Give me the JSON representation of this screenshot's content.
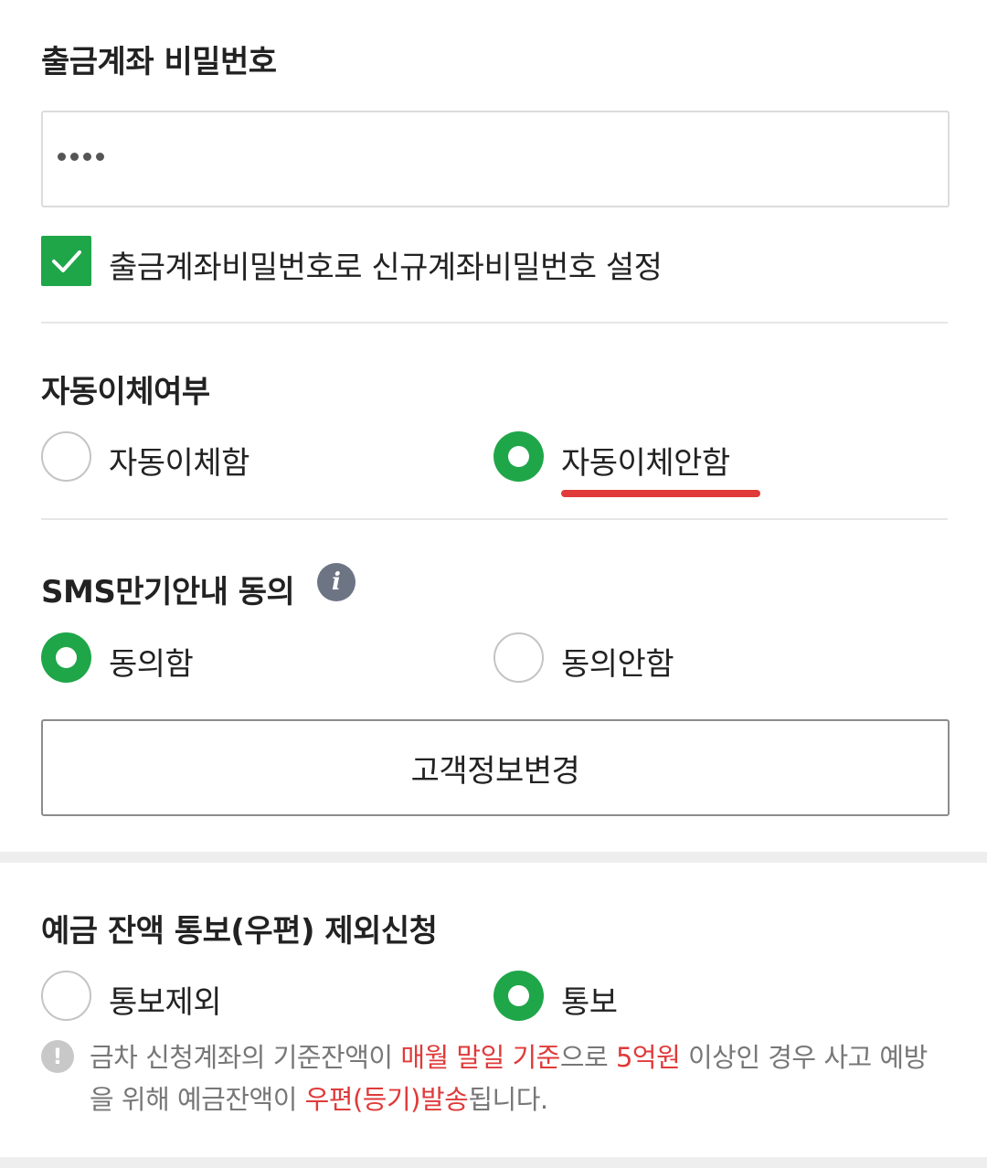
{
  "password_section": {
    "title": "출금계좌 비밀번호",
    "input_masked_length": 4,
    "checkbox_label": "출금계좌비밀번호로 신규계좌비밀번호 설정",
    "checkbox_checked": true
  },
  "auto_transfer": {
    "title": "자동이체여부",
    "options": [
      {
        "label": "자동이체함",
        "selected": false
      },
      {
        "label": "자동이체안함",
        "selected": true
      }
    ]
  },
  "sms_consent": {
    "title": "SMS만기안내 동의",
    "info_icon_text": "i",
    "options": [
      {
        "label": "동의함",
        "selected": true
      },
      {
        "label": "동의안함",
        "selected": false
      }
    ]
  },
  "customer_info_button": "고객정보변경",
  "balance_notice": {
    "title": "예금 잔액 통보(우편) 제외신청",
    "options": [
      {
        "label": "통보제외",
        "selected": false
      },
      {
        "label": "통보",
        "selected": true
      }
    ],
    "notice_parts": {
      "p1": "금차 신청계좌의 기준잔액이 ",
      "r1": "매월 말일 기준",
      "p2": "으로 ",
      "r2": "5억원",
      "p3": " 이상인 경우 사고 예방을 위해 예금잔액이 ",
      "r3": "우편(등기)발송",
      "p4": "됩니다."
    }
  },
  "colors": {
    "accent_green": "#1fa649",
    "highlight_red": "#e03a3a"
  }
}
